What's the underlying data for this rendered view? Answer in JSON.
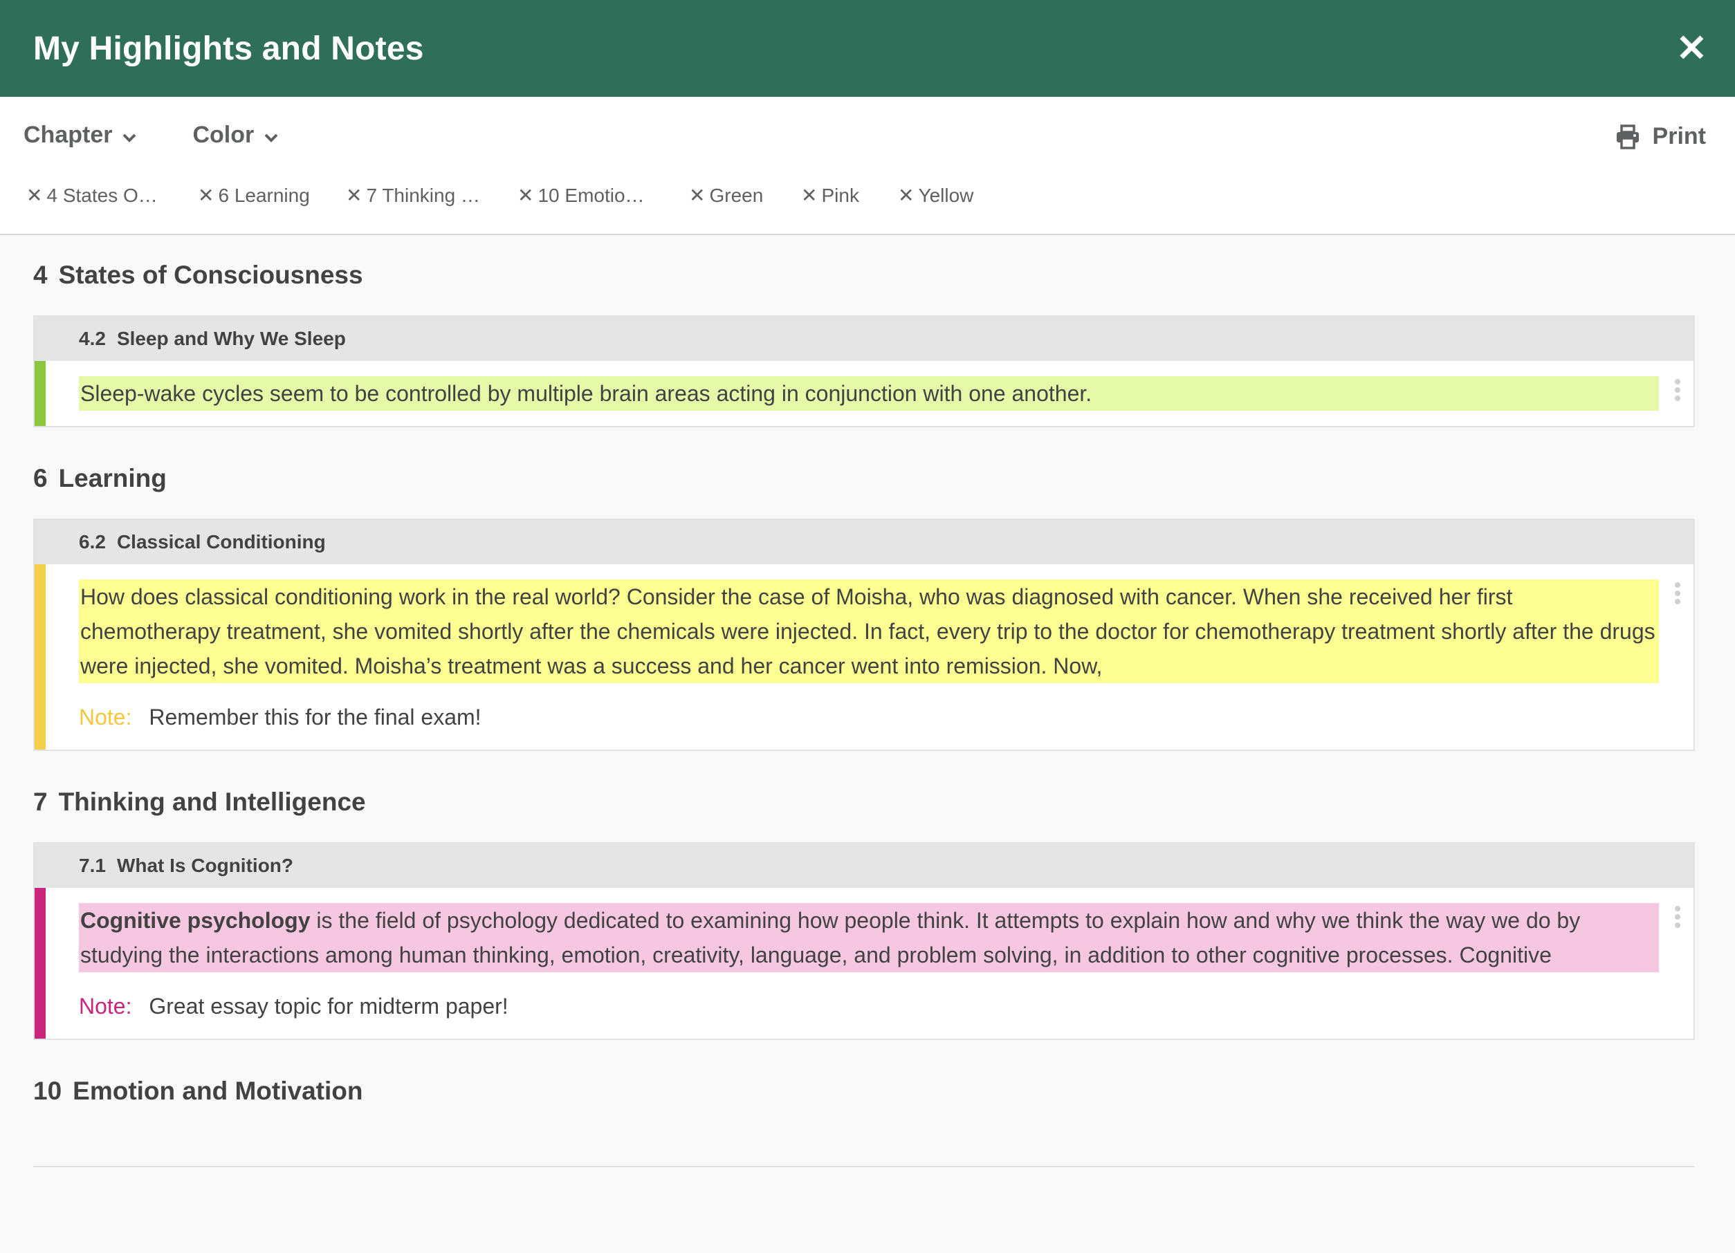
{
  "header": {
    "title": "My Highlights and Notes",
    "close_label": "✕"
  },
  "filters": {
    "chapter_label": "Chapter",
    "color_label": "Color",
    "print_label": "Print",
    "pills": [
      "4 States O…",
      "6 Learning",
      "7 Thinking …",
      "10 Emotio…",
      "Green",
      "Pink",
      "Yellow"
    ]
  },
  "colors": {
    "green_bar": "#8cc63f",
    "green_bg": "#e5f9a9",
    "yellow_bar": "#f3cf4b",
    "yellow_bg": "#fdff92",
    "yellow_note": "#f3c83e",
    "pink_bar": "#c8267a",
    "pink_bg": "#f5c7e1",
    "pink_note": "#c8267a"
  },
  "chapters": [
    {
      "num": "4",
      "title": "States of Consciousness",
      "section": {
        "num": "4.2",
        "title": "Sleep and Why We Sleep"
      },
      "highlight": "Sleep-wake cycles seem to be controlled by multiple brain areas acting in conjunction with one another."
    },
    {
      "num": "6",
      "title": "Learning",
      "section": {
        "num": "6.2",
        "title": "Classical Conditioning"
      },
      "highlight": "How does classical conditioning work in the real world? Consider the case of Moisha, who was diagnosed with cancer. When she received her first chemotherapy treatment, she vomited shortly after the chemicals were injected. In fact, every trip to the doctor for chemotherapy treatment shortly after the drugs were injected, she vomited. Moisha’s treatment was a success and her cancer went into remission. Now,",
      "note_label": "Note:",
      "note_text": "Remember this for the final exam!"
    },
    {
      "num": "7",
      "title": "Thinking and Intelligence",
      "section": {
        "num": "7.1",
        "title": "What Is Cognition?"
      },
      "highlight_bold": "Cognitive psychology",
      "highlight": " is the field of psychology dedicated to examining how people think. It attempts to explain how and why we think the way we do by studying the interactions among human thinking, emotion, creativity, language, and problem solving, in addition to other cognitive processes. Cognitive",
      "note_label": "Note:",
      "note_text": "Great essay topic for midterm paper!"
    },
    {
      "num": "10",
      "title": "Emotion and Motivation"
    }
  ]
}
